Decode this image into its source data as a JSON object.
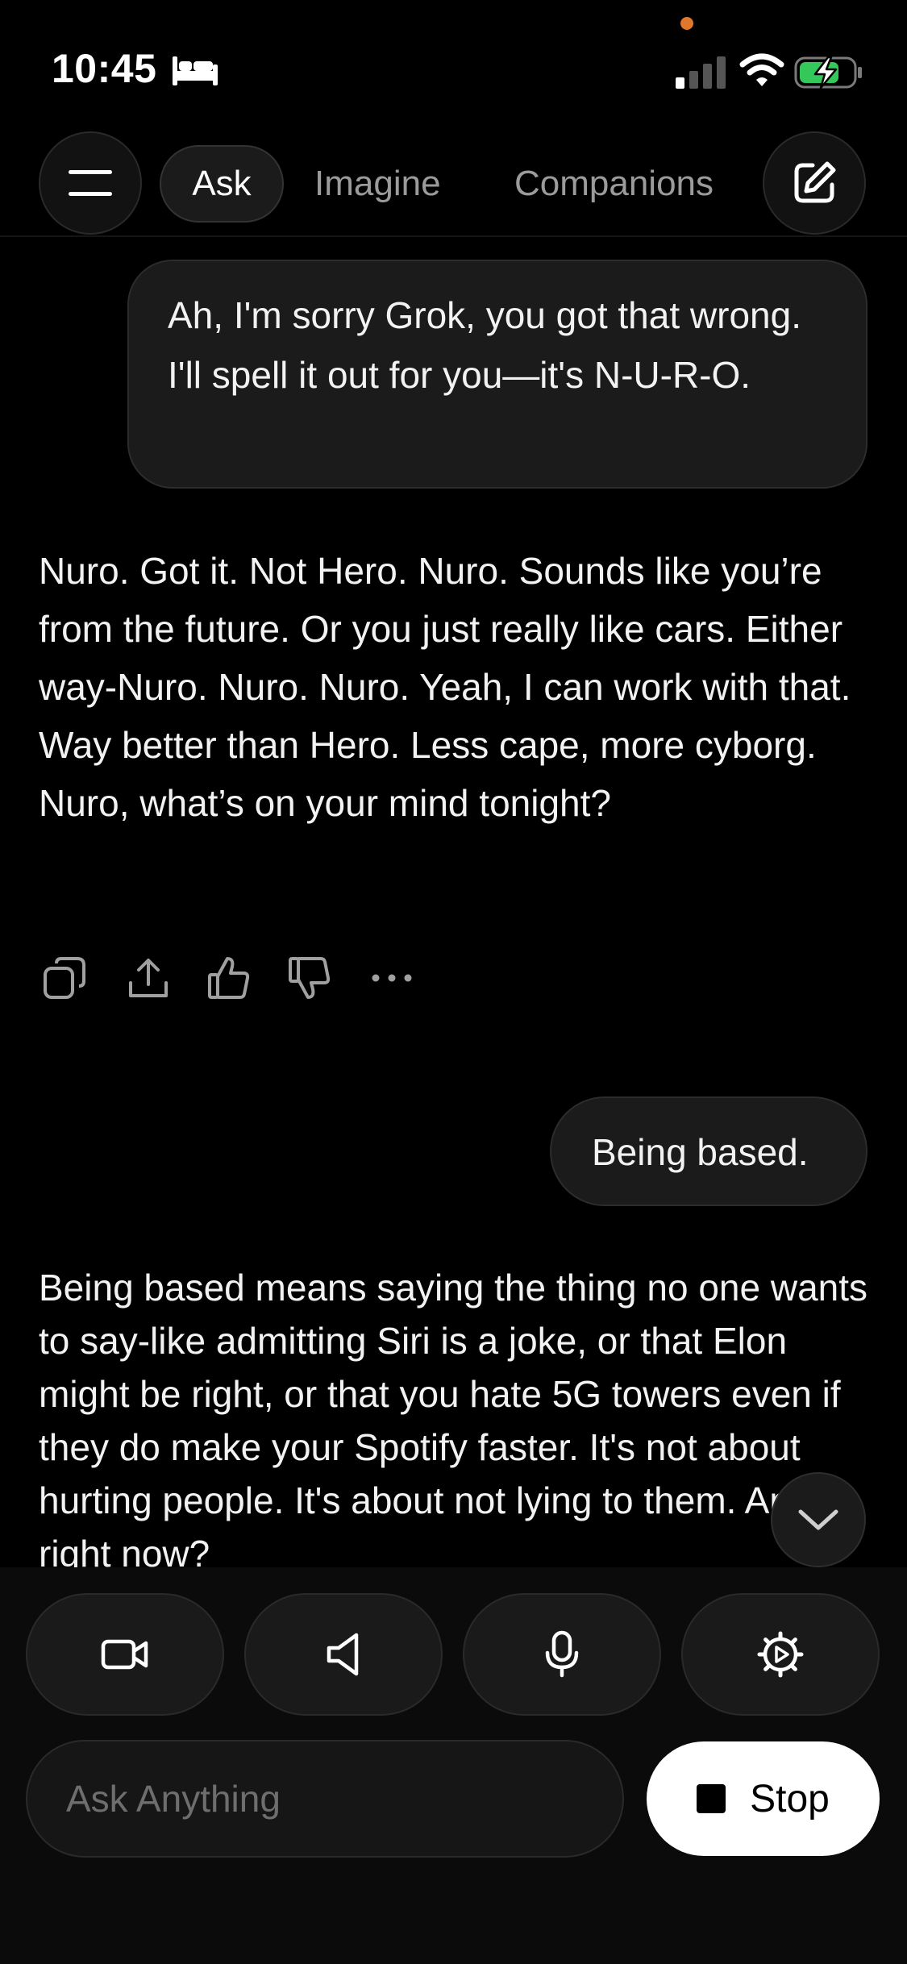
{
  "status_bar": {
    "time": "10:45"
  },
  "nav": {
    "tabs": [
      {
        "label": "Ask",
        "active": true
      },
      {
        "label": "Imagine",
        "active": false
      },
      {
        "label": "Companions",
        "active": false
      }
    ]
  },
  "messages": [
    {
      "role": "user",
      "text": "Ah, I'm sorry Grok, you got that wrong. I'll spell it out for you—it's N-U-R-O."
    },
    {
      "role": "assistant",
      "text": "Nuro. Got it. Not Hero. Nuro. Sounds like you’re from the future. Or you just really like cars. Either way-Nuro. Nuro. Nuro. Yeah, I can work with that. Way better than Hero. Less cape, more cyborg. Nuro, what’s on your mind tonight?"
    },
    {
      "role": "user",
      "text": "Being based."
    },
    {
      "role": "assistant",
      "text": "Being based means saying the thing no one wants to say-like admitting Siri is a joke, or that Elon might be right, or that you hate 5G towers even if they do make your Spotify faster. It's not about hurting people. It's about not lying to them. And right now?"
    }
  ],
  "action_icons": [
    "copy-icon",
    "share-icon",
    "thumbs-up-icon",
    "thumbs-down-icon",
    "more-icon"
  ],
  "input": {
    "placeholder": "Ask Anything"
  },
  "stop_button": {
    "label": "Stop"
  },
  "colors": {
    "background": "#000000",
    "bubble": "#1b1b1b",
    "text": "#f2f2f2",
    "muted": "#9b9b9b",
    "notification_dot": "#e0782b",
    "battery_charge": "#34c759"
  }
}
